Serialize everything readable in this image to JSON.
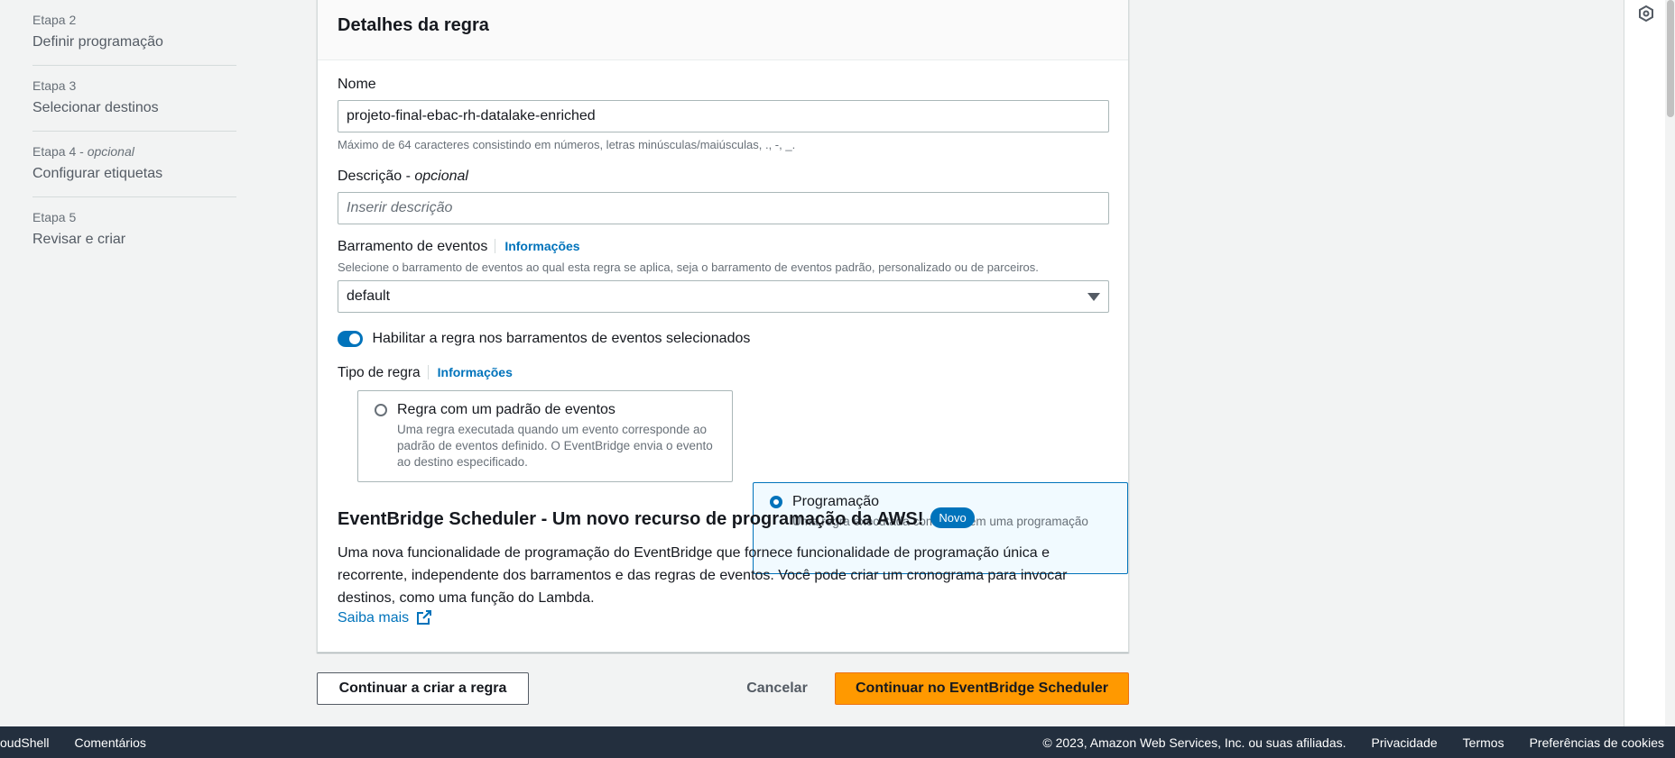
{
  "steps": [
    {
      "num": "Etapa 2",
      "num_suffix": "",
      "name": "Definir programação"
    },
    {
      "num": "Etapa 3",
      "num_suffix": "",
      "name": "Selecionar destinos"
    },
    {
      "num": "Etapa 4 - ",
      "num_suffix": "opcional",
      "name": "Configurar etiquetas"
    },
    {
      "num": "Etapa 5",
      "num_suffix": "",
      "name": "Revisar e criar"
    }
  ],
  "panel": {
    "title": "Detalhes da regra",
    "name_label": "Nome",
    "name_value": "projeto-final-ebac-rh-datalake-enriched",
    "name_hint": "Máximo de 64 caracteres consistindo em números, letras minúsculas/maiúsculas, ., -, _.",
    "desc_label": "Descrição - ",
    "desc_label_opt": "opcional",
    "desc_placeholder": "Inserir descrição",
    "bus_label": "Barramento de eventos",
    "bus_info": "Informações",
    "bus_hint": "Selecione o barramento de eventos ao qual esta regra se aplica, seja o barramento de eventos padrão, personalizado ou de parceiros.",
    "bus_value": "default",
    "toggle_label": "Habilitar a regra nos barramentos de eventos selecionados",
    "rule_type_label": "Tipo de regra",
    "rule_type_info": "Informações",
    "tiles": [
      {
        "title": "Regra com um padrão de eventos",
        "desc": "Uma regra executada quando um evento corresponde ao padrão de eventos definido. O EventBridge envia o evento ao destino especificado.",
        "selected": false
      },
      {
        "title": "Programação",
        "desc": "Uma regra executada com base em uma programação",
        "selected": true
      }
    ],
    "scheduler_heading": "EventBridge Scheduler - Um novo recurso de programação da AWS!",
    "scheduler_badge": "Novo",
    "scheduler_text": "Uma nova funcionalidade de programação do EventBridge que fornece funcionalidade de programação única e recorrente, independente dos barramentos e das regras de eventos. Você pode criar um cronograma para invocar destinos, como uma função do Lambda.",
    "learn_more": "Saiba mais"
  },
  "actions": {
    "continue_rule": "Continuar a criar a regra",
    "cancel": "Cancelar",
    "continue_scheduler": "Continuar no EventBridge Scheduler"
  },
  "footer": {
    "cloudshell": "oudShell",
    "feedback": "Comentários",
    "copyright": "© 2023, Amazon Web Services, Inc. ou suas afiliadas.",
    "privacy": "Privacidade",
    "terms": "Termos",
    "cookies": "Preferências de cookies"
  },
  "colors": {
    "accent": "#0073bb",
    "primary_button": "#ff9900",
    "footer": "#232f3e"
  }
}
